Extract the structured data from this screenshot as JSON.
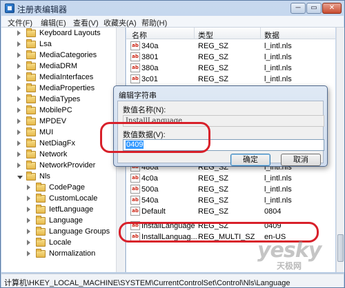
{
  "window": {
    "title": "注册表编辑器",
    "min_glyph": "─",
    "max_glyph": "▭",
    "close_glyph": "✕"
  },
  "menu": [
    "文件(F)",
    "编辑(E)",
    "查看(V)",
    "收藏夹(A)",
    "帮助(H)"
  ],
  "tree": [
    {
      "label": "Keyboard Layouts",
      "expanded": false
    },
    {
      "label": "Lsa",
      "expanded": false
    },
    {
      "label": "MediaCategories",
      "expanded": false
    },
    {
      "label": "MediaDRM",
      "expanded": false
    },
    {
      "label": "MediaInterfaces",
      "expanded": false
    },
    {
      "label": "MediaProperties",
      "expanded": false
    },
    {
      "label": "MediaTypes",
      "expanded": false
    },
    {
      "label": "MobilePC",
      "expanded": false
    },
    {
      "label": "MPDEV",
      "expanded": false
    },
    {
      "label": "MUI",
      "expanded": false
    },
    {
      "label": "NetDiagFx",
      "expanded": false
    },
    {
      "label": "Network",
      "expanded": false
    },
    {
      "label": "NetworkProvider",
      "expanded": false
    },
    {
      "label": "Nls",
      "expanded": true
    },
    {
      "label": "CodePage",
      "expanded": false
    },
    {
      "label": "CustomLocale",
      "expanded": false
    },
    {
      "label": "IetfLanguage",
      "expanded": false
    },
    {
      "label": "Language",
      "expanded": false
    },
    {
      "label": "Language Groups",
      "expanded": false
    },
    {
      "label": "Locale",
      "expanded": false
    },
    {
      "label": "Normalization",
      "expanded": false
    }
  ],
  "list": {
    "columns": [
      "名称",
      "类型",
      "数据"
    ],
    "rows": [
      {
        "name": "340a",
        "type": "REG_SZ",
        "data": "l_intl.nls"
      },
      {
        "name": "3801",
        "type": "REG_SZ",
        "data": "l_intl.nls"
      },
      {
        "name": "380a",
        "type": "REG_SZ",
        "data": "l_intl.nls"
      },
      {
        "name": "3c01",
        "type": "REG_SZ",
        "data": "l_intl.nls"
      },
      {
        "name": "480a",
        "type": "REG_SZ",
        "data": "l_intl.nls"
      },
      {
        "name": "4c0a",
        "type": "REG_SZ",
        "data": "l_intl.nls"
      },
      {
        "name": "500a",
        "type": "REG_SZ",
        "data": "l_intl.nls"
      },
      {
        "name": "540a",
        "type": "REG_SZ",
        "data": "l_intl.nls"
      },
      {
        "name": "Default",
        "type": "REG_SZ",
        "data": "0804"
      },
      {
        "name": "InstallLanguage",
        "type": "REG_SZ",
        "data": "0409"
      },
      {
        "name": "InstallLanguag...",
        "type": "REG_MULTI_SZ",
        "data": "en-US"
      }
    ],
    "icon_text": "ab"
  },
  "dialog": {
    "title": "编辑字符串",
    "name_label": "数值名称(N):",
    "name_value": "InstallLanguage",
    "data_label": "数值数据(V):",
    "data_value": "0409",
    "ok_label": "确定",
    "cancel_label": "取消"
  },
  "status": {
    "path": "计算机\\HKEY_LOCAL_MACHINE\\SYSTEM\\CurrentControlSet\\Control\\Nls\\Language"
  },
  "watermark": {
    "text": "yesky",
    "sub": "天极网"
  },
  "colors": {
    "highlight": "#d8202a",
    "selection": "#3399ff"
  }
}
